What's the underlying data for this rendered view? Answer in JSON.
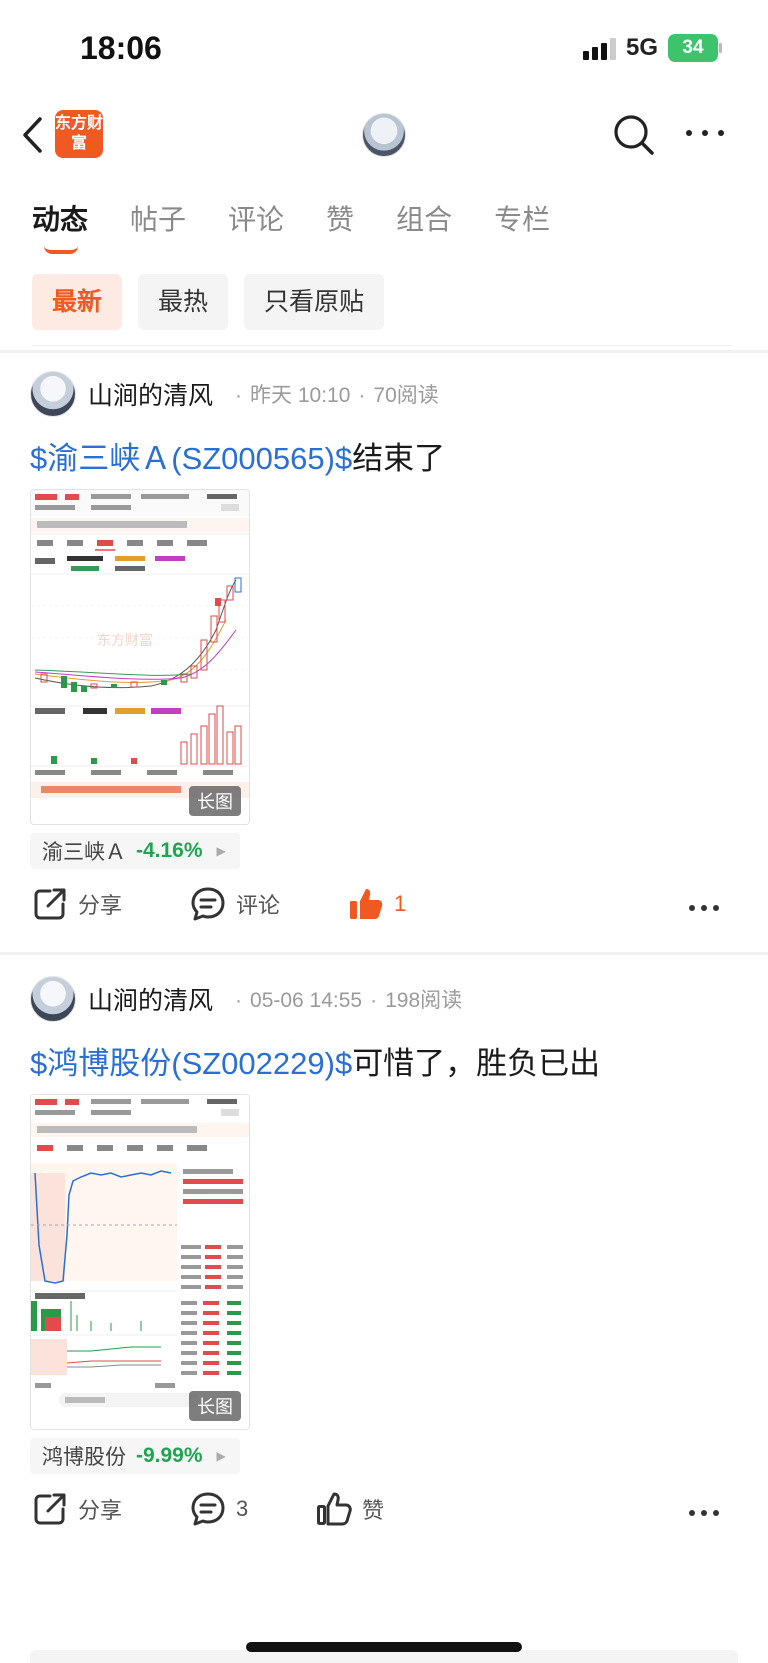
{
  "status_bar": {
    "time": "18:06",
    "network": "5G",
    "battery": "34"
  },
  "nav": {
    "logo_text": "东方财富"
  },
  "tabs": [
    "动态",
    "帖子",
    "评论",
    "赞",
    "组合",
    "专栏"
  ],
  "filters": [
    "最新",
    "最热",
    "只看原贴"
  ],
  "posts": [
    {
      "author": "山涧的清风",
      "time": "昨天 10:10",
      "reads": "70阅读",
      "title_link": "$渝三峡Ａ(SZ000565)$",
      "title_text": "结束了",
      "image_badge": "长图",
      "stock_name": "渝三峡Ａ",
      "stock_change": "-4.16%",
      "share_label": "分享",
      "comment_label": "评论",
      "like_count": "1"
    },
    {
      "author": "山涧的清风",
      "time": "05-06 14:55",
      "reads": "198阅读",
      "title_link": "$鸿博股份(SZ002229)$",
      "title_text": "可惜了，胜负已出",
      "image_badge": "长图",
      "stock_name": "鸿博股份",
      "stock_change": "-9.99%",
      "share_label": "分享",
      "comment_label": "3",
      "like_label": "赞"
    }
  ],
  "colors": {
    "accent": "#f05a22",
    "link": "#2a6fd6",
    "down": "#1fa451"
  }
}
